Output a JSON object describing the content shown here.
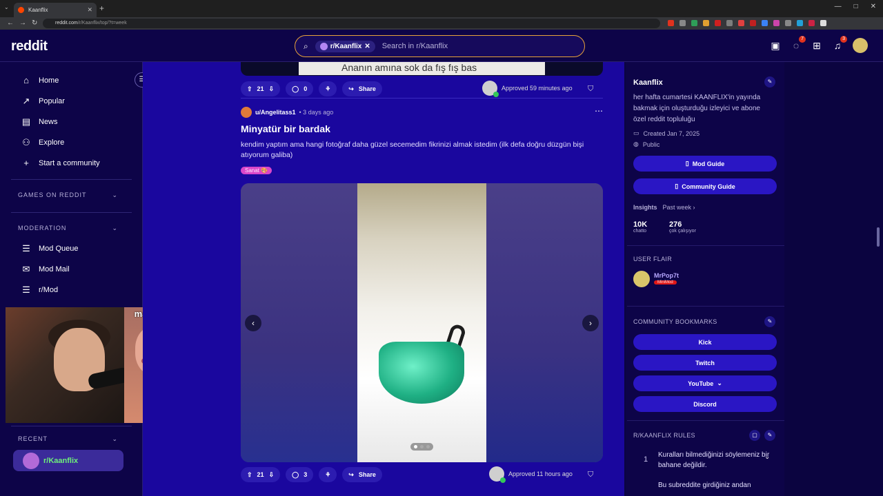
{
  "browser": {
    "tab_title": "Kaanflix",
    "url_host": "reddit.com",
    "url_path": "/r/Kaanflix/top/?t=week",
    "ext_colors": [
      "#e0321e",
      "#888",
      "#2e9d58",
      "#e0a030",
      "#d02020",
      "#7d7d7d",
      "#e04040",
      "#c02020",
      "#3b82f6",
      "#cc44aa",
      "#888",
      "#22a0d8",
      "#cc2244",
      "#ddd"
    ]
  },
  "header": {
    "logo": "reddit",
    "search_chip": "r/Kaanflix",
    "search_placeholder": "Search in r/Kaanflix",
    "chat_badge": "7",
    "notif_badge": "3"
  },
  "left_nav": {
    "items": [
      {
        "label": "Home",
        "icon": "home-icon",
        "glyph": "⌂"
      },
      {
        "label": "Popular",
        "icon": "popular-icon",
        "glyph": "↗"
      },
      {
        "label": "News",
        "icon": "news-icon",
        "glyph": "▤"
      },
      {
        "label": "Explore",
        "icon": "explore-icon",
        "glyph": "⚇"
      },
      {
        "label": "Start a community",
        "icon": "plus-icon",
        "glyph": "+"
      }
    ],
    "games_section": "GAMES ON REDDIT",
    "moderation_section": "MODERATION",
    "mod_items": [
      {
        "label": "Mod Queue",
        "icon": "mod-queue-icon",
        "glyph": "☰"
      },
      {
        "label": "Mod Mail",
        "icon": "mod-mail-icon",
        "glyph": "✉"
      },
      {
        "label": "r/Mod",
        "icon": "mod-icon",
        "glyph": "☰"
      }
    ],
    "recent_section": "RECENT",
    "recent_item": "r/Kaanflix"
  },
  "webcam": {
    "overlay_tag": "maanklik"
  },
  "feed": {
    "prev_post": {
      "meme_text": "Ananın amına sok da fış fış bas",
      "votes": "21",
      "comments": "0",
      "share": "Share",
      "approved": "Approved 59 minutes ago"
    },
    "post": {
      "author": "u/Angelitass1",
      "time": "• 3 days ago",
      "title": "Minyatür bir bardak",
      "body": "kendim yaptım ama hangi fotoğraf daha güzel secemedim fikrinizi almak istedim (ilk defa doğru düzgün bişi atıyorum galiba)",
      "flair": "Sanat 🎨",
      "votes": "21",
      "comments": "3",
      "share": "Share",
      "approved": "Approved 11 hours ago",
      "gallery_count": 3,
      "gallery_index": 1
    }
  },
  "right": {
    "community": "Kaanflix",
    "description": "her hafta cumartesi KAANFLIX'in yayında bakmak için oluşturduğu izleyici ve abone özel reddit topluluğu",
    "created": "Created Jan 7, 2025",
    "visibility": "Public",
    "mod_guide": "Mod Guide",
    "community_guide": "Community Guide",
    "insights_label": "Insights",
    "insights_period": "Past week ›",
    "stat1_num": "10K",
    "stat1_lbl": "chatto",
    "stat2_num": "276",
    "stat2_lbl": "çok çalışıyor",
    "user_flair_title": "USER FLAIR",
    "flair_user": "MrPop7t",
    "flair_tag": "MiniMod",
    "bookmarks_title": "COMMUNITY BOOKMARKS",
    "bookmarks": [
      "Kick",
      "Twitch",
      "YouTube",
      "Discord"
    ],
    "rules_title": "R/KAANFLIX RULES",
    "rule1_num": "1",
    "rule1": "Kuralları bilmediğinizi söylemeniz bir bahane değildir.",
    "rule2": "Bu subreddite girdiğiniz andan"
  }
}
